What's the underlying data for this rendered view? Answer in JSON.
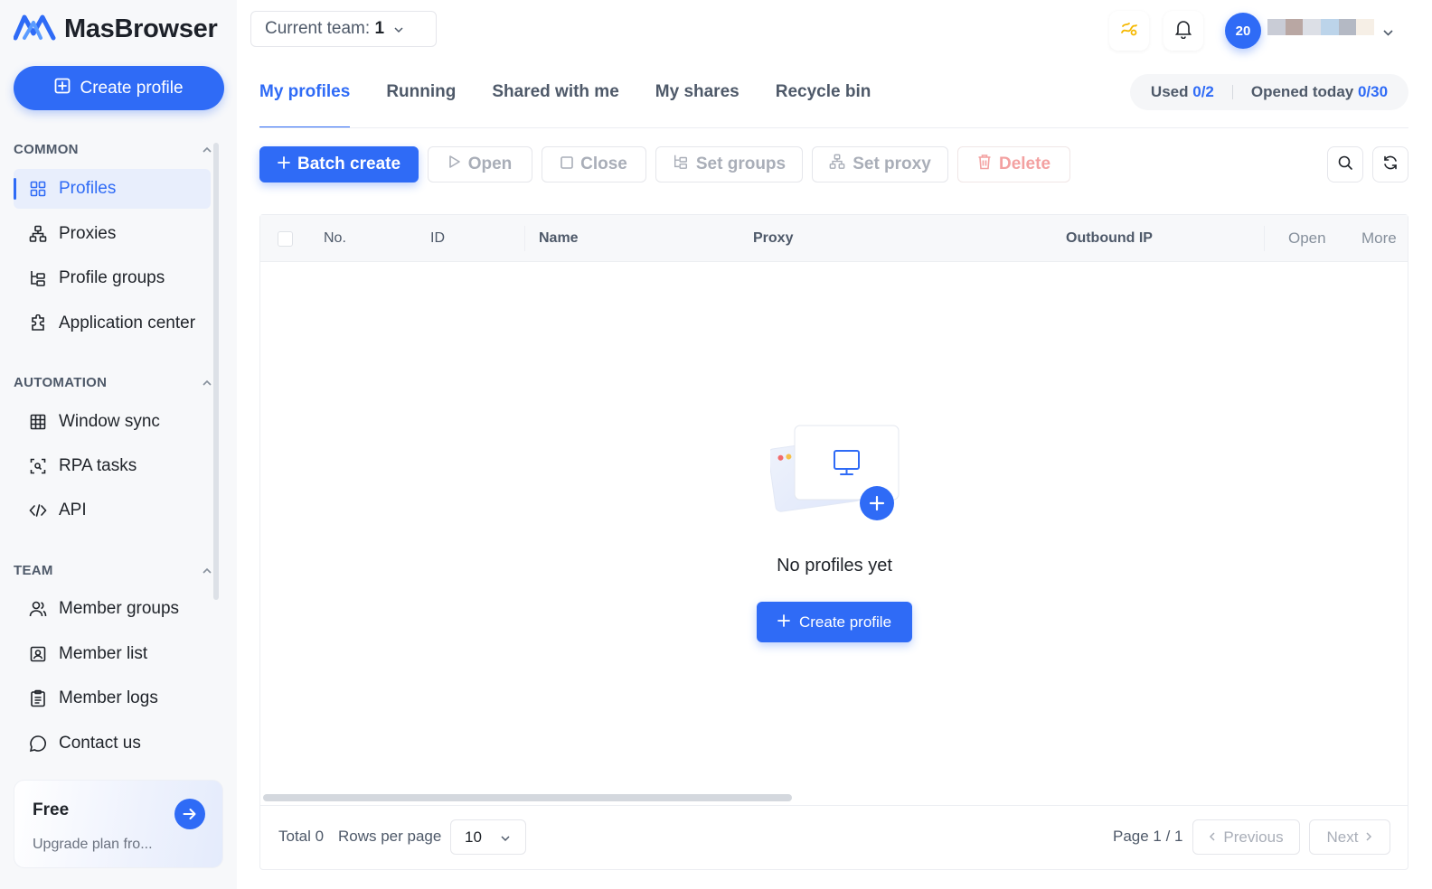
{
  "app": {
    "name": "MasBrowser"
  },
  "sidebar": {
    "create_profile_label": "Create profile",
    "sections": {
      "common": {
        "title": "COMMON"
      },
      "automation": {
        "title": "AUTOMATION"
      },
      "team": {
        "title": "TEAM"
      }
    },
    "items": {
      "profiles": "Profiles",
      "proxies": "Proxies",
      "profile_groups": "Profile groups",
      "application_center": "Application center",
      "window_sync": "Window sync",
      "rpa_tasks": "RPA tasks",
      "api": "API",
      "member_groups": "Member groups",
      "member_list": "Member list",
      "member_logs": "Member logs",
      "contact_us": "Contact us"
    },
    "plan": {
      "title": "Free",
      "subtitle": "Upgrade plan fro..."
    }
  },
  "header": {
    "team_label": "Current team:",
    "team_value": "1",
    "avatar_text": "20"
  },
  "tabs": [
    "My profiles",
    "Running",
    "Shared with me",
    "My shares",
    "Recycle bin"
  ],
  "usage": {
    "used_label": "Used",
    "used_value": "0/2",
    "opened_label": "Opened today",
    "opened_value": "0/30"
  },
  "toolbar": {
    "batch_create": "Batch create",
    "open": "Open",
    "close": "Close",
    "set_groups": "Set groups",
    "set_proxy": "Set proxy",
    "delete": "Delete"
  },
  "table": {
    "columns": {
      "no": "No.",
      "id": "ID",
      "name": "Name",
      "proxy": "Proxy",
      "outbound_ip": "Outbound IP",
      "open": "Open",
      "more": "More"
    },
    "rows": [],
    "empty_text": "No profiles yet",
    "empty_button": "Create profile"
  },
  "footer": {
    "total": "Total 0",
    "rows_per_page_label": "Rows per page",
    "rows_per_page_value": "10",
    "page_info": "Page 1 / 1",
    "previous": "Previous",
    "next": "Next"
  },
  "colors": {
    "primary": "#2f6bf6",
    "sidebar_bg": "#f7f8fa",
    "danger_muted": "#f3a1a1"
  }
}
